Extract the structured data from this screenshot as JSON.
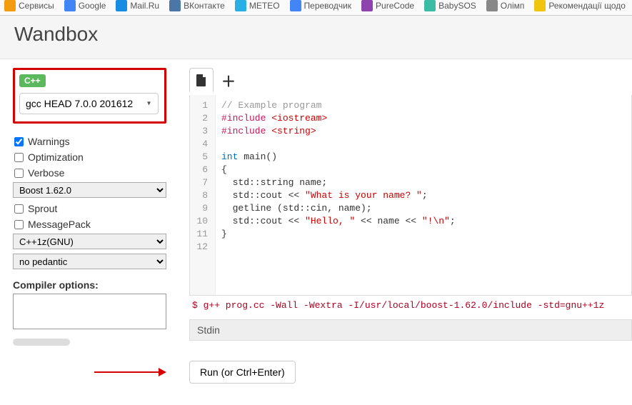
{
  "bookmarks": [
    {
      "label": "Сервисы",
      "color": "#f39c12"
    },
    {
      "label": "Google",
      "color": "#4285f4"
    },
    {
      "label": "Mail.Ru",
      "color": "#168de2"
    },
    {
      "label": "ВКонтакте",
      "color": "#4a76a8"
    },
    {
      "label": "METEO",
      "color": "#28b0e4"
    },
    {
      "label": "Переводчик",
      "color": "#4285f4"
    },
    {
      "label": "PureCode",
      "color": "#8e44ad"
    },
    {
      "label": "BabySOS",
      "color": "#3bbca4"
    },
    {
      "label": "Олімп",
      "color": "#888"
    },
    {
      "label": "Рекомендації щодо",
      "color": "#f1c40f"
    }
  ],
  "header": {
    "title": "Wandbox"
  },
  "sidebar": {
    "lang_badge": "C++",
    "compiler": "gcc HEAD 7.0.0 201612",
    "options": [
      {
        "label": "Warnings",
        "checked": true
      },
      {
        "label": "Optimization",
        "checked": false
      },
      {
        "label": "Verbose",
        "checked": false
      }
    ],
    "boost_select": "Boost 1.62.0",
    "options2": [
      {
        "label": "Sprout",
        "checked": false
      },
      {
        "label": "MessagePack",
        "checked": false
      }
    ],
    "std_select": "C++1z(GNU)",
    "pedantic_select": "no pedantic",
    "compiler_options_label": "Compiler options:",
    "compiler_options_value": ""
  },
  "editor": {
    "lines": [
      {
        "n": 1,
        "html": "<span class='c-comment'>// Example program</span>"
      },
      {
        "n": 2,
        "html": "<span class='c-pink'>#include</span> <span class='c-red'>&lt;iostream&gt;</span>"
      },
      {
        "n": 3,
        "html": "<span class='c-pink'>#include</span> <span class='c-red'>&lt;string&gt;</span>"
      },
      {
        "n": 4,
        "html": ""
      },
      {
        "n": 5,
        "html": "<span class='c-blue'>int</span> main()"
      },
      {
        "n": 6,
        "html": "{"
      },
      {
        "n": 7,
        "html": "  std::string name;"
      },
      {
        "n": 8,
        "html": "  std::cout &lt;&lt; <span class='c-red'>\"What is your name? \"</span>;"
      },
      {
        "n": 9,
        "html": "  getline (std::cin, name);"
      },
      {
        "n": 10,
        "html": "  std::cout &lt;&lt; <span class='c-red'>\"Hello, \"</span> &lt;&lt; name &lt;&lt; <span class='c-red'>\"!\\n\"</span>;"
      },
      {
        "n": 11,
        "html": "}"
      },
      {
        "n": 12,
        "html": ""
      }
    ],
    "command_line": "$ g++ prog.cc -Wall -Wextra -I/usr/local/boost-1.62.0/include -std=gnu++1z",
    "stdin_label": "Stdin",
    "run_label": "Run (or Ctrl+Enter)"
  }
}
